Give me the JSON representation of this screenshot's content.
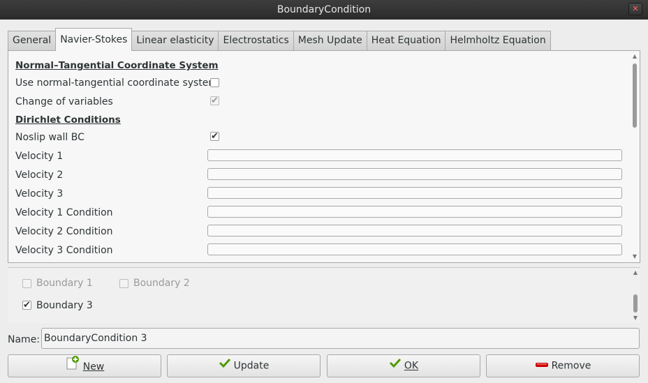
{
  "window": {
    "title": "BoundaryCondition"
  },
  "tabs": [
    {
      "label": "General"
    },
    {
      "label": "Navier-Stokes"
    },
    {
      "label": "Linear elasticity"
    },
    {
      "label": "Electrostatics"
    },
    {
      "label": "Mesh Update"
    },
    {
      "label": "Heat Equation"
    },
    {
      "label": "Helmholtz Equation"
    }
  ],
  "navier": {
    "section1": "Normal–Tangential Coordinate System",
    "use_nt_label": "Use normal-tangential coordinate system",
    "use_nt_checked": false,
    "change_vars_label": "Change of variables",
    "change_vars_checked": true,
    "section2": "Dirichlet Conditions",
    "noslip_label": "Noslip wall BC",
    "noslip_checked": true,
    "fields": [
      {
        "label": "Velocity 1",
        "value": ""
      },
      {
        "label": "Velocity 2",
        "value": ""
      },
      {
        "label": "Velocity 3",
        "value": ""
      },
      {
        "label": "Velocity 1 Condition",
        "value": ""
      },
      {
        "label": "Velocity 2 Condition",
        "value": ""
      },
      {
        "label": "Velocity 3 Condition",
        "value": ""
      }
    ]
  },
  "boundaries": [
    {
      "label": "Boundary 1",
      "checked": false,
      "enabled": false
    },
    {
      "label": "Boundary 2",
      "checked": false,
      "enabled": false
    },
    {
      "label": "Boundary 3",
      "checked": true,
      "enabled": true
    }
  ],
  "name": {
    "label": "Name:",
    "value": "BoundaryCondition 3"
  },
  "buttons": {
    "new": "New",
    "update": "Update",
    "ok": "OK",
    "remove": "Remove"
  },
  "colors": {
    "check_green": "#4e9a06",
    "remove_red": "#cc0000"
  }
}
